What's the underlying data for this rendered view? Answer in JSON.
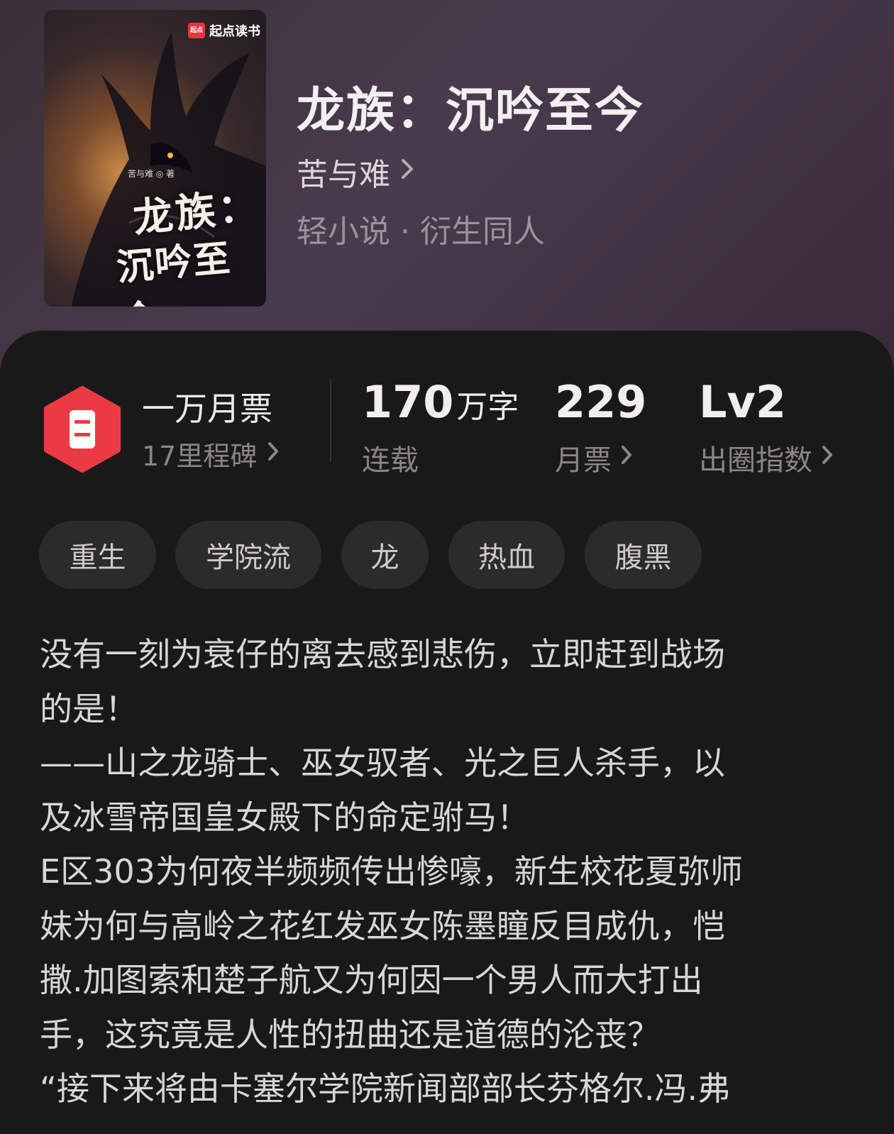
{
  "cover": {
    "brand_mark": "起点",
    "brand": "起点读书",
    "author_tag": "苦与难 ◎ 著",
    "title_line1": "龙族：",
    "title_line2": "沉吟至今"
  },
  "book": {
    "title": "龙族：沉吟至今",
    "author": "苦与难",
    "genre": "轻小说 · 衍生同人"
  },
  "stats": {
    "milestone_title": "一万月票",
    "milestone_sub": "17里程碑",
    "words_value": "170",
    "words_unit": "万字",
    "words_label": "连载",
    "tickets_value": "229",
    "tickets_label": "月票",
    "level_value": "Lv2",
    "level_label": "出圈指数"
  },
  "tags": [
    "重生",
    "学院流",
    "龙",
    "热血",
    "腹黑"
  ],
  "synopsis": [
    "没有一刻为衰仔的离去感到悲伤，立即赶到战场",
    "的是！",
    "——山之龙骑士、巫女驭者、光之巨人杀手，以",
    "及冰雪帝国皇女殿下的命定驸马！",
    "E区303为何夜半频频传出惨嚎，新生校花夏弥师",
    "妹为何与高岭之花红发巫女陈墨瞳反目成仇，恺",
    "撒.加图索和楚子航又为何因一个男人而大打出",
    "手，这究竟是人性的扭曲还是道德的沦丧？",
    "“接下来将由卡塞尔学院新闻部部长芬格尔.冯.弗"
  ],
  "colors": {
    "accent": "#e8343c",
    "panel_bg": "#1a1919",
    "tag_bg": "#2c2b2b"
  }
}
